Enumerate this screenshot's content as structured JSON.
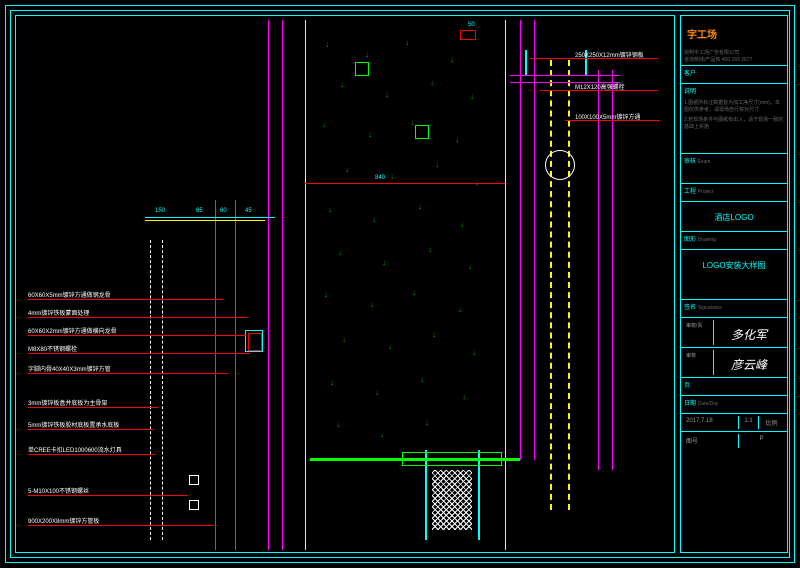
{
  "title_block": {
    "logo": "字工场",
    "company": "昆明字工场广告有限公司",
    "phone": "咨询热线/产品热 400 155 2877",
    "client_lbl": "客户",
    "client": "",
    "notes_lbl": "说明",
    "notes": "1.图纸所标注数据皆为加工净尺寸(mm)。本图仅供参考，请现场自行核对尺寸",
    "notes2": "2.若现场条件与图纸有出入，请于现场一致的基础上实施",
    "review_lbl": "审核",
    "review_en": "Exam",
    "project_lbl": "工程",
    "project_en": "Project",
    "project": "酒店LOGO",
    "drawing_lbl": "图形",
    "drawing_en": "Drawing",
    "drawing": "LOGO安装大样图",
    "sig_lbl": "签名",
    "sig_en": "Signatures",
    "cell_a": "审核/责",
    "cell_b": "审核",
    "sig1": "多化军",
    "sig2": "彦云峰",
    "page_lbl": "页",
    "date_lbl": "日期",
    "date_en": "Date/Day",
    "date": "2017.7.18",
    "scale_lbl": "比例",
    "scale": "1:1",
    "no_lbl": "图号",
    "no": "P"
  },
  "dims": {
    "d50": "50",
    "d840": "840",
    "d150": "150",
    "d65": "65",
    "d60": "60",
    "d45": "45"
  },
  "left_labels": {
    "l1": "60X60X5mm镀锌方通做钢龙骨",
    "l2": "4mm镀锌铁板蒙面处理",
    "l3": "60X60X2mm镀锌方通做横向龙骨",
    "l4": "M8X80不锈钢螺栓",
    "l5": "字脚内骨40X40X3mm镀锌方管",
    "l6": "3mm镀锌板盒并底板为主骨架",
    "l7": "5mm镀锌铁板胶材底板置承水底板",
    "l8": "单CREE卡扣LED1000600流水灯具",
    "l9": "5-M10X100不锈钢螺丝",
    "l10": "900X200X8mm镀锌方管板"
  },
  "right_labels": {
    "r1": "250X250X12mm镀锌钢板",
    "r2": "M12X120高强螺栓",
    "r3": "100X100X5mm镀锌方通"
  }
}
